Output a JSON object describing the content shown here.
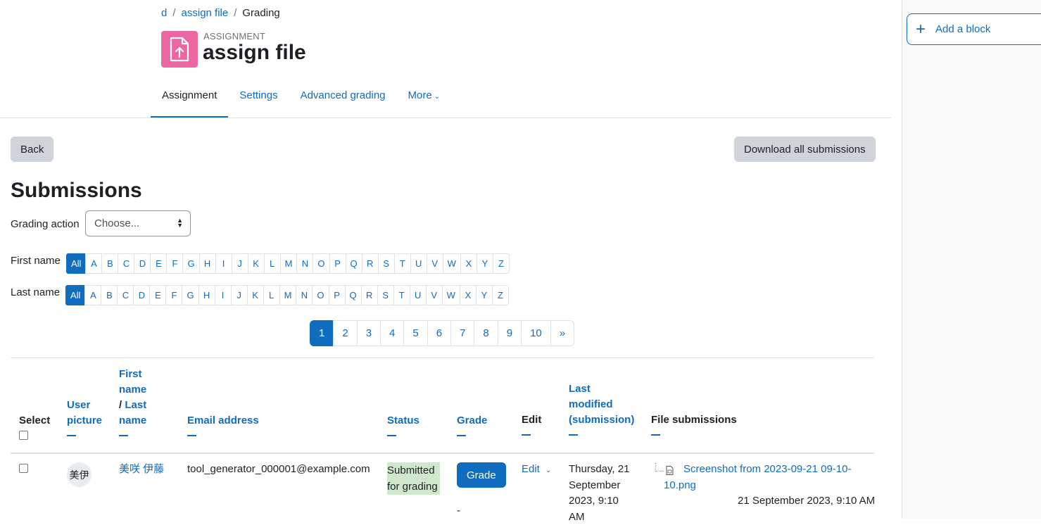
{
  "breadcrumb": {
    "items": [
      "d",
      "assign file"
    ],
    "current": "Grading"
  },
  "activity": {
    "preheader": "ASSIGNMENT",
    "title": "assign file",
    "icon": "file-upload-icon",
    "icon_color": "#eb66a2"
  },
  "tabs": [
    {
      "label": "Assignment",
      "active": true
    },
    {
      "label": "Settings"
    },
    {
      "label": "Advanced grading"
    },
    {
      "label": "More"
    }
  ],
  "drawer": {
    "add_block": "Add a block"
  },
  "buttons": {
    "back": "Back",
    "download_all": "Download all submissions"
  },
  "section_title": "Submissions",
  "grading_action": {
    "label": "Grading action",
    "selected": "Choose..."
  },
  "first_name_filter": {
    "label": "First name",
    "options": [
      "All",
      "A",
      "B",
      "C",
      "D",
      "E",
      "F",
      "G",
      "H",
      "I",
      "J",
      "K",
      "L",
      "M",
      "N",
      "O",
      "P",
      "Q",
      "R",
      "S",
      "T",
      "U",
      "V",
      "W",
      "X",
      "Y",
      "Z"
    ]
  },
  "last_name_filter": {
    "label": "Last name",
    "options": [
      "All",
      "A",
      "B",
      "C",
      "D",
      "E",
      "F",
      "G",
      "H",
      "I",
      "J",
      "K",
      "L",
      "M",
      "N",
      "O",
      "P",
      "Q",
      "R",
      "S",
      "T",
      "U",
      "V",
      "W",
      "X",
      "Y",
      "Z"
    ]
  },
  "pagination": {
    "pages": [
      "1",
      "2",
      "3",
      "4",
      "5",
      "6",
      "7",
      "8",
      "9",
      "10"
    ],
    "next": "»",
    "current": "1"
  },
  "table": {
    "headers": {
      "select": "Select",
      "user_picture_1": "User",
      "user_picture_2": "picture",
      "first_name_1": "First",
      "first_name_2": "name",
      "slash": "/",
      "last_name_1": "Last",
      "last_name_2": "name",
      "email": "Email address",
      "status": "Status",
      "grade": "Grade",
      "edit": "Edit",
      "last_modified_1": "Last",
      "last_modified_2": "modified",
      "last_modified_3": "(submission)",
      "file_submissions": "File submissions"
    },
    "rows": [
      {
        "avatar_initials": "美伊",
        "name": "美咲 伊藤",
        "email": "tool_generator_000001@example.com",
        "status_1": "Submitted",
        "status_2": "for grading",
        "grade_button": "Grade",
        "grade_value": "-",
        "edit": "Edit",
        "modified_1": "Thursday, 21",
        "modified_2": "September",
        "modified_3": "2023, 9:10",
        "modified_4": "AM",
        "file_name_1": "Screenshot from 2023-09-21 09-10-",
        "file_name_2": "10.png",
        "file_date": "21 September 2023, 9:10 AM"
      }
    ]
  },
  "colors": {
    "primary": "#0f6cbf",
    "status_submitted_bg": "#cfe8cc",
    "secondary_button": "#ced4da"
  }
}
